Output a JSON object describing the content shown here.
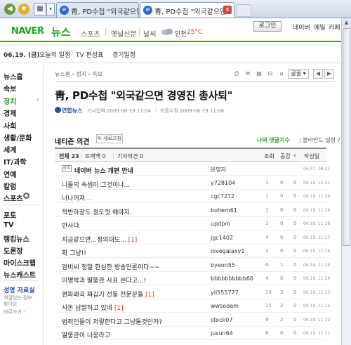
{
  "browser": {
    "tabs": [
      {
        "title": "靑, PD수첩 \"외국같으면",
        "active": false
      },
      {
        "title": "靑, PD수첩 \"외국같으면",
        "active": true
      }
    ]
  },
  "header": {
    "logo": "NAVER",
    "section": "뉴스",
    "nav": [
      "스포츠",
      "옛날신문",
      "날씨"
    ],
    "weather_city": "인천",
    "weather_temp": "25°C",
    "login_label": "로그인",
    "links": [
      "네이버",
      "메일",
      "카페"
    ]
  },
  "datebar": {
    "date": "06.19. (금)",
    "items": [
      "오늘의 일정",
      "TV 편성표",
      "경기일정"
    ]
  },
  "sidebar": {
    "items": [
      {
        "label": "뉴스홈",
        "active": false
      },
      {
        "label": "속보",
        "active": false
      },
      {
        "label": "정치",
        "active": true
      },
      {
        "label": "경제",
        "active": false
      },
      {
        "label": "사회",
        "active": false
      },
      {
        "label": "생활/문화",
        "active": false
      },
      {
        "label": "세계",
        "active": false
      },
      {
        "label": "IT/과학",
        "active": false
      },
      {
        "label": "연예",
        "active": false
      },
      {
        "label": "칼럼",
        "active": false
      },
      {
        "label": "스포츠",
        "active": false
      }
    ],
    "items2": [
      "포토",
      "TV",
      "랭킹뉴스",
      "도론장",
      "마이스크랩",
      "뉴스캐스트"
    ],
    "promo_title": "성명 자료실",
    "promo_lines": [
      "색깔있는 정보",
      "찾아요"
    ],
    "promo_more": "바로가기 ›"
  },
  "article": {
    "breadcrumb": "뉴스홈 › 정치 › 속보",
    "font_size_label": "글꼴",
    "title": "靑, PD수첩 \"외국같으면 경영진 총사퇴\"",
    "agency": "연합뉴스",
    "published": "기사입력 2009-06-19 11:04",
    "modified": "최종수정 2009-06-19 11:08"
  },
  "comments": {
    "heading": "네티즌 의견",
    "refresh_label": "새로고침",
    "my_comments": "나의 댓글지수",
    "blind_setting": "블라인드 설정",
    "filters": [
      "전체 23",
      "트랙백 0",
      "기자의견 0"
    ],
    "columns": [
      "조회",
      "공감",
      "작성일"
    ],
    "notice_badge": "공지",
    "rows": [
      {
        "title": "네이버 뉴스 개편 안내",
        "count": "",
        "author": "운영자",
        "views": "",
        "likes": "",
        "bad": "",
        "date": "06.07. 08:21",
        "notice": true
      },
      {
        "title": "니들의 속셈이 그것이냐...",
        "count": "",
        "author": "y728104",
        "views": "1",
        "likes": "0",
        "bad": "0",
        "date": "06.19. 11:31",
        "notice": false
      },
      {
        "title": "너나꺼져...",
        "count": "",
        "author": "cgc7272",
        "views": "1",
        "likes": "0",
        "bad": "0",
        "date": "06.19. 11:30",
        "notice": false
      },
      {
        "title": "적반하장도 정도껏 해야지.",
        "count": "",
        "author": "bohem61",
        "views": "1",
        "likes": "0",
        "bad": "0",
        "date": "06.19. 11:29",
        "notice": false
      },
      {
        "title": "반사다",
        "count": "",
        "author": "updpro",
        "views": "3",
        "likes": "0",
        "bad": "0",
        "date": "06.19. 11:28",
        "notice": false
      },
      {
        "title": "지금같으면...정의대도...",
        "count": "[1]",
        "author": "jgc1402",
        "views": "4",
        "likes": "0",
        "bad": "0",
        "date": "06.19. 11:27",
        "notice": false
      },
      {
        "title": "확 그냥!!",
        "count": "",
        "author": "lovegalaxy1",
        "views": "4",
        "likes": "0",
        "bad": "0",
        "date": "06.19. 11:26",
        "notice": false
      },
      {
        "title": "엄비씨 정말 한심한 방송언론이다~~",
        "count": "",
        "author": "byeon55",
        "views": "6",
        "likes": "1",
        "bad": "0",
        "date": "06.19. 11:25",
        "notice": false
      },
      {
        "title": "이명박과 딸뚱관 사표 쓴다고...!",
        "count": "",
        "author": "bbbbbbbbbb66",
        "views": "4",
        "likes": "0",
        "bad": "0",
        "date": "06.19. 11:24",
        "notice": false
      },
      {
        "title": "편파왜곡 짜깁기 선동 전문꾼들",
        "count": "[1]",
        "author": "yii555777",
        "views": "10",
        "likes": "3",
        "bad": "0",
        "date": "06.19. 11:23",
        "notice": false
      },
      {
        "title": "사돈 남말하고 있네",
        "count": "[1]",
        "author": "wwsodam",
        "views": "15",
        "likes": "2",
        "bad": "0",
        "date": "06.19. 11:22",
        "notice": false
      },
      {
        "title": "범죄인들이 저렇한다고 그냥둘것인가?",
        "count": "",
        "author": "stock07",
        "views": "8",
        "likes": "2",
        "bad": "0",
        "date": "06.19. 11:22",
        "notice": false
      },
      {
        "title": "딸뚱관이 나옹라고",
        "count": "",
        "author": "jusun64",
        "views": "6",
        "likes": "0",
        "bad": "0",
        "date": "06.19. 11:21",
        "notice": false
      }
    ]
  }
}
